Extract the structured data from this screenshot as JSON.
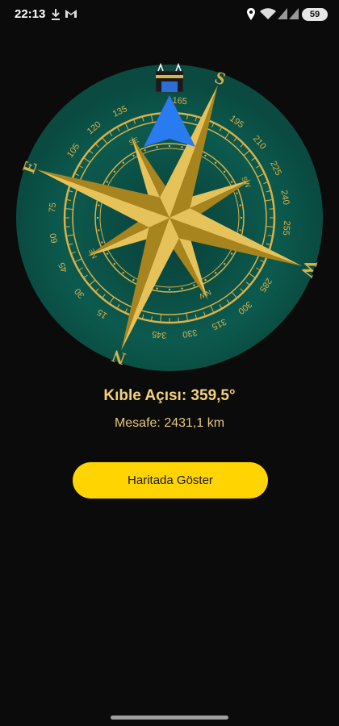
{
  "status_bar": {
    "time": "22:13",
    "battery": "59",
    "icons": [
      "download-icon",
      "gmail-icon",
      "location-icon",
      "wifi-icon",
      "signal-icon",
      "signal-icon",
      "battery-icon"
    ]
  },
  "compass": {
    "cardinals": [
      "N",
      "E",
      "S",
      "W"
    ],
    "degree_labels": [
      "15",
      "30",
      "45",
      "60",
      "75",
      "105",
      "120",
      "135",
      "165",
      "195",
      "210",
      "225",
      "240",
      "255",
      "285",
      "300",
      "315",
      "330",
      "345"
    ],
    "inner_labels": [
      "SE",
      "SW",
      "NW",
      "NE"
    ],
    "pointer_icon": "kaaba-icon",
    "needle_icon": "arrow-up-icon",
    "colors": {
      "ring": "#0c5a4e",
      "gold": "#d8b24a"
    }
  },
  "qibla": {
    "angle_text": "Kıble Açısı: 359,5°",
    "distance_text": "Mesafe: 2431,1 km",
    "map_button_label": "Haritada Göster"
  }
}
